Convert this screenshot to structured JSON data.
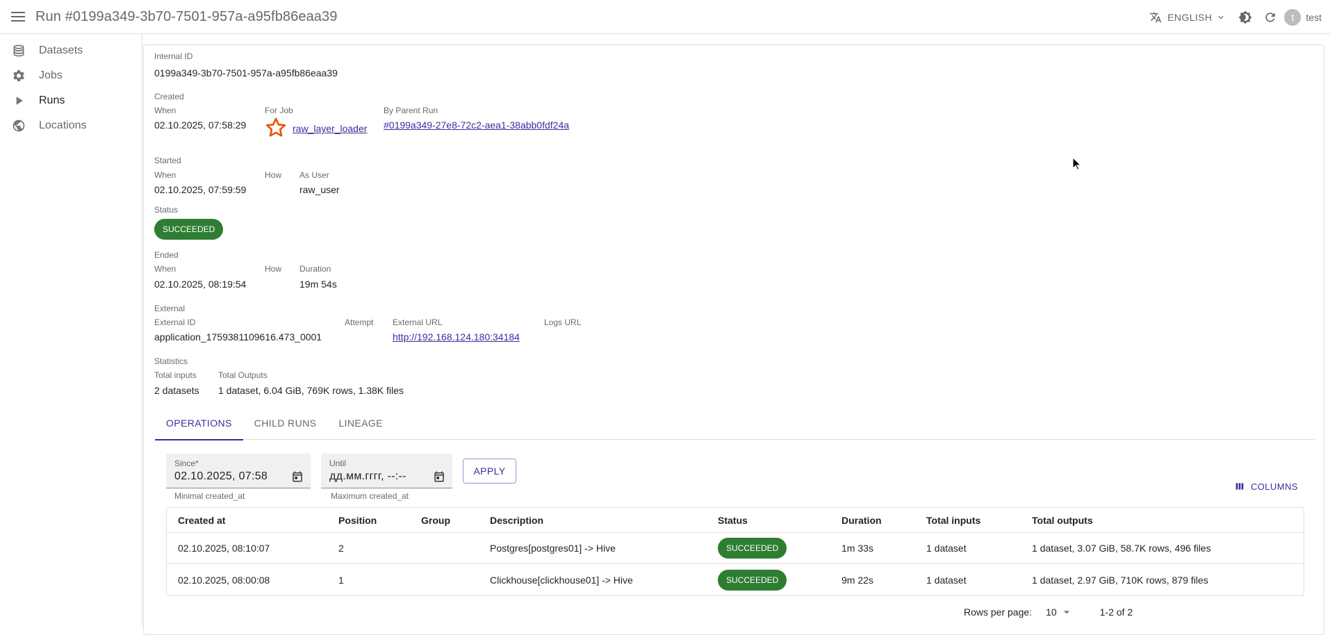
{
  "appbar": {
    "title": "Run #0199a349-3b70-7501-957a-a95fb86eaa39",
    "language": "ENGLISH",
    "user_initial": "t",
    "user_name": "test"
  },
  "sidebar": {
    "items": [
      {
        "label": "Datasets",
        "icon": "database-icon"
      },
      {
        "label": "Jobs",
        "icon": "gear-icon"
      },
      {
        "label": "Runs",
        "icon": "play-icon"
      },
      {
        "label": "Locations",
        "icon": "globe-icon"
      }
    ]
  },
  "run": {
    "internal_id_label": "Internal ID",
    "internal_id": "0199a349-3b70-7501-957a-a95fb86eaa39",
    "created": {
      "section": "Created",
      "when_label": "When",
      "when": "02.10.2025, 07:58:29",
      "for_job_label": "For Job",
      "job_name": "raw_layer_loader",
      "parent_label": "By Parent Run",
      "parent_run": "#0199a349-27e8-72c2-aea1-38abb0fdf24a"
    },
    "started": {
      "section": "Started",
      "when_label": "When",
      "when": "02.10.2025, 07:59:59",
      "how_label": "How",
      "as_user_label": "As User",
      "as_user": "raw_user"
    },
    "status": {
      "section": "Status",
      "value": "SUCCEEDED"
    },
    "ended": {
      "section": "Ended",
      "when_label": "When",
      "when": "02.10.2025, 08:19:54",
      "how_label": "How",
      "duration_label": "Duration",
      "duration": "19m 54s"
    },
    "external": {
      "section": "External",
      "external_id_label": "External ID",
      "external_id": "application_1759381109616.473_0001",
      "attempt_label": "Attempt",
      "url_label": "External URL",
      "url": "http://192.168.124.180:34184",
      "logs_label": "Logs URL"
    },
    "statistics": {
      "section": "Statistics",
      "inputs_label": "Total inputs",
      "inputs": "2 datasets",
      "outputs_label": "Total Outputs",
      "outputs": "1 dataset, 6.04 GiB, 769K rows, 1.38K files"
    }
  },
  "tabs": [
    "OPERATIONS",
    "CHILD RUNS",
    "LINEAGE"
  ],
  "filters": {
    "since_label": "Since*",
    "since_value": "02.10.2025, 07:58",
    "since_helper": "Minimal created_at",
    "until_label": "Until",
    "until_placeholder": "дд.мм.гггг, --:--",
    "until_helper": "Maximum created_at",
    "apply": "APPLY",
    "columns": "COLUMNS"
  },
  "table": {
    "headers": [
      "Created at",
      "Position",
      "Group",
      "Description",
      "Status",
      "Duration",
      "Total inputs",
      "Total outputs"
    ],
    "rows": [
      {
        "created_at": "02.10.2025, 08:10:07",
        "position": "2",
        "group": "",
        "description": "Postgres[postgres01] -> Hive",
        "status": "SUCCEEDED",
        "duration": "1m 33s",
        "inputs": "1 dataset",
        "outputs": "1 dataset, 3.07 GiB, 58.7K rows, 496 files"
      },
      {
        "created_at": "02.10.2025, 08:00:08",
        "position": "1",
        "group": "",
        "description": "Clickhouse[clickhouse01] -> Hive",
        "status": "SUCCEEDED",
        "duration": "9m 22s",
        "inputs": "1 dataset",
        "outputs": "1 dataset, 2.97 GiB, 710K rows, 879 files"
      }
    ]
  },
  "pagination": {
    "rows_per_page_label": "Rows per page:",
    "rows_per_page": "10",
    "range": "1-2 of 2"
  },
  "colors": {
    "accent": "#4527a0",
    "success": "#2e7d32",
    "job_star": "#e65100"
  }
}
